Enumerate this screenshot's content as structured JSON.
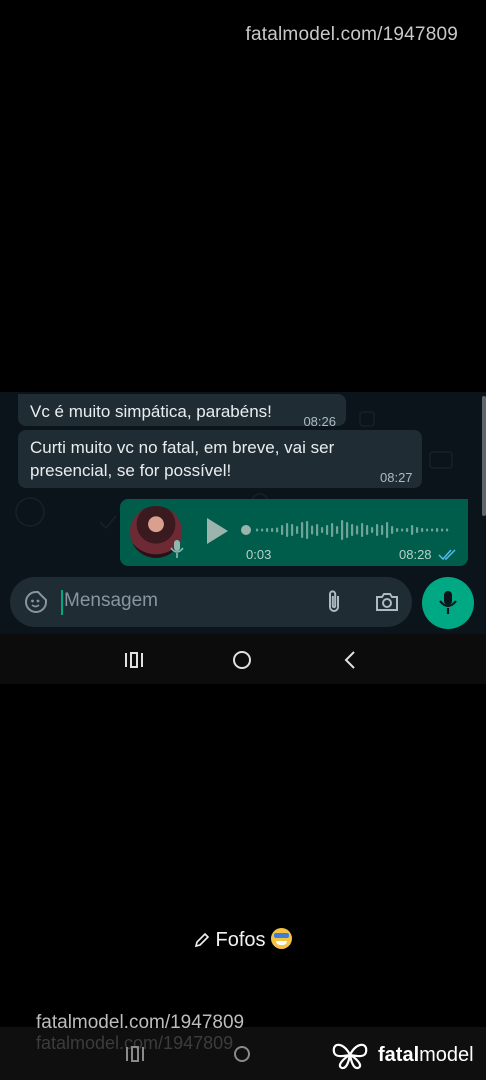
{
  "watermark_top": "fatalmodel.com/1947809",
  "chat": {
    "incoming": [
      {
        "text": "Vc é muito simpática, parabéns!",
        "time": "08:26"
      },
      {
        "text": "Curti muito vc no fatal, em breve, vai ser presencial, se for possível!",
        "time": "08:27"
      }
    ],
    "voice_message": {
      "duration": "0:03",
      "time": "08:28",
      "status_icon": "double-check-read-icon"
    },
    "input": {
      "placeholder": "Mensagem"
    }
  },
  "caption": {
    "text": "Fofos"
  },
  "footer": {
    "watermark": "fatalmodel.com/1947809",
    "watermark_ghost": "fatalmodel.com/1947809",
    "brand_bold": "fatal",
    "brand_rest": "model"
  },
  "colors": {
    "accent": "#00a884",
    "outgoing_bubble": "#005c4b",
    "incoming_bubble": "#202c33",
    "chat_background": "#0b141a"
  }
}
